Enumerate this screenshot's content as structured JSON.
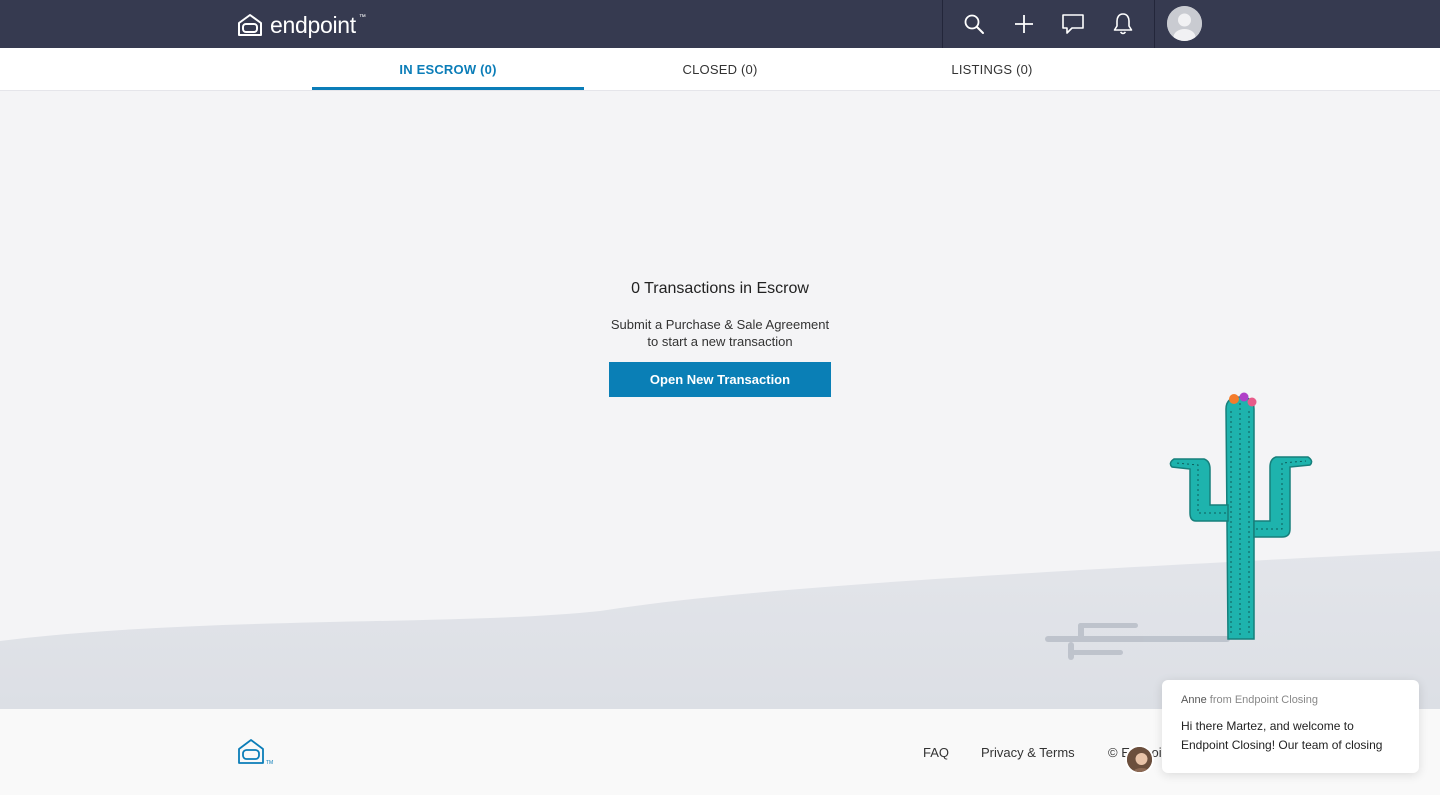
{
  "header": {
    "brand": "endpoint",
    "brand_tm": "™",
    "icons": [
      "search-icon",
      "plus-icon",
      "chat-icon",
      "bell-icon"
    ]
  },
  "tabs": [
    {
      "label": "IN ESCROW (0)",
      "active": true
    },
    {
      "label": "CLOSED (0)",
      "active": false
    },
    {
      "label": "LISTINGS (0)",
      "active": false
    }
  ],
  "empty_state": {
    "title": "0 Transactions in Escrow",
    "line1": "Submit a Purchase & Sale Agreement",
    "line2": "to start a new transaction",
    "button": "Open New Transaction"
  },
  "footer": {
    "faq": "FAQ",
    "privacy": "Privacy & Terms",
    "copyright": "© Endpoi"
  },
  "chat": {
    "sender": "Anne",
    "sender_suffix": "from Endpoint Closing",
    "line1": "Hi there Martez, and welcome to",
    "line2": "Endpoint Closing!  Our team of closing"
  },
  "colors": {
    "topbar": "#363a50",
    "accent": "#0b7db8",
    "cactus": "#1eb3ad"
  }
}
